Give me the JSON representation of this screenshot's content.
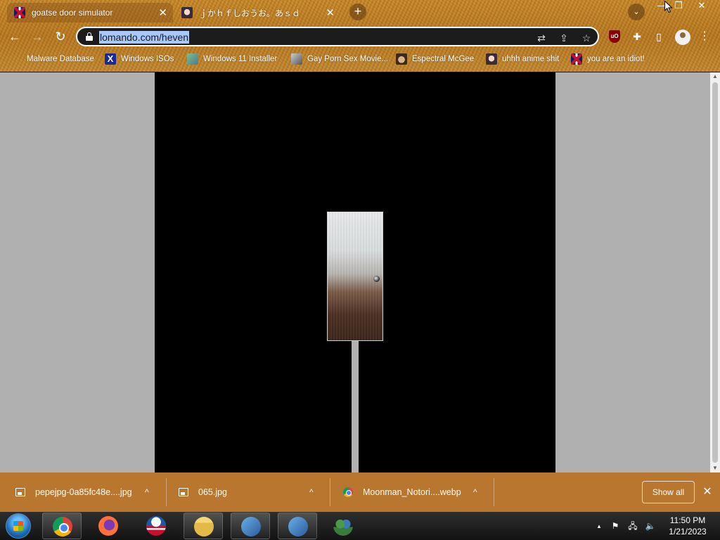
{
  "browser": {
    "tabs": [
      {
        "title": "goatse door simulator",
        "close": "✕",
        "active": true
      },
      {
        "title": "ｊかｈｆしおうお。あｓｄ",
        "close": "✕",
        "active": false
      }
    ],
    "new_tab": "+",
    "tab_search": "⌄",
    "window_controls": {
      "minimize": "—",
      "restore": "❐",
      "close": "✕"
    },
    "nav": {
      "back": "←",
      "forward": "→",
      "reload": "↻"
    },
    "address": {
      "url": "lomando.com/heven"
    },
    "omnibox_icons": {
      "translate": "⇄",
      "share": "⇪",
      "bookmark": "☆"
    },
    "extensions": {
      "ublock": "uO",
      "puzzle": "✚",
      "sidepanel": "▯"
    },
    "menu": "⋮",
    "bookmarks": [
      {
        "label": "Malware Database",
        "icon": "no-icon"
      },
      {
        "label": "Windows ISOs",
        "icon": "x-icon",
        "glyph": "X"
      },
      {
        "label": "Windows 11 Installer",
        "icon": "window-icon"
      },
      {
        "label": "Gay Porn Sex Movie...",
        "icon": "computer-icon"
      },
      {
        "label": "Espectral McGee",
        "icon": "face-icon"
      },
      {
        "label": "uhhh anime shit",
        "icon": "anime-icon"
      },
      {
        "label": "you are an idiot!",
        "icon": "uk-flag-icon"
      }
    ]
  },
  "page": {
    "background": "#000000",
    "side_background": "#b0b0b0",
    "scroll": {
      "up": "▲",
      "down": "▼"
    }
  },
  "downloads": {
    "items": [
      {
        "name": "pepejpg-0a85fc48e....jpg",
        "icon": "image-file-icon"
      },
      {
        "name": "065.jpg",
        "icon": "image-file-icon"
      },
      {
        "name": "Moonman_Notori....webp",
        "icon": "chrome-file-icon"
      }
    ],
    "caret": "^",
    "show_all": "Show all",
    "close": "✕"
  },
  "taskbar": {
    "apps": [
      {
        "name": "chrome",
        "open": true
      },
      {
        "name": "firefox",
        "open": false
      },
      {
        "name": "obama",
        "open": false
      },
      {
        "name": "file-explorer",
        "open": true
      },
      {
        "name": "network-1",
        "open": true
      },
      {
        "name": "network-2",
        "open": true
      },
      {
        "name": "users",
        "open": false
      }
    ],
    "tray": {
      "chevron": "▴",
      "flag": "⚑",
      "network": "🖧",
      "volume": "🔈"
    },
    "clock": {
      "time": "11:50 PM",
      "date": "1/21/2023"
    }
  }
}
